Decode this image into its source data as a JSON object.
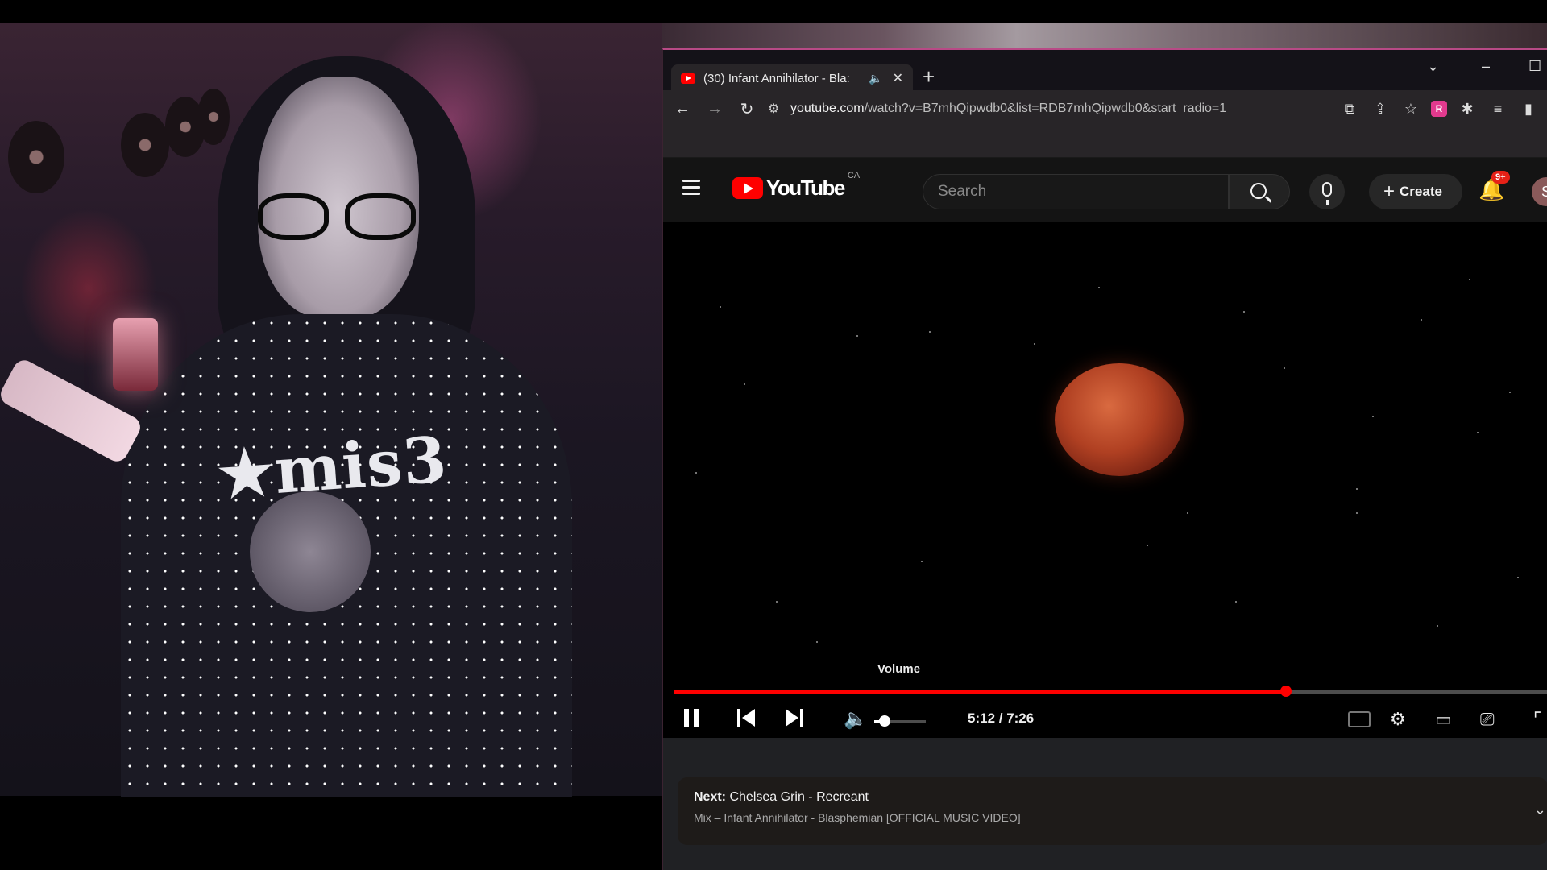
{
  "browser": {
    "tab_title": "(30) Infant Annihilator - Bla:",
    "tab_icons": {
      "favicon": "youtube-favicon",
      "audio": "speaker-icon",
      "close": "close-icon"
    },
    "new_tab_label": "+",
    "url_host": "youtube.com",
    "url_path": "/watch?v=B7mhQipwdb0&list=RDB7mhQipwdb0&start_radio=1",
    "window_controls": {
      "dropdown": "⌄",
      "minimize": "–",
      "maximize": "☐"
    }
  },
  "youtube": {
    "logo_text": "YouTube",
    "country_code": "CA",
    "search_placeholder": "Search",
    "create_label": "Create",
    "notification_badge": "9+",
    "avatar_letter": "S",
    "accent_color": "#ff0000"
  },
  "player": {
    "tooltip": "Volume",
    "time_display": "5:12 / 7:26",
    "progress_fraction": 0.7,
    "volume_fraction": 0.2,
    "is_playing": true
  },
  "up_next": {
    "label": "Next:",
    "title": "Chelsea Grin - Recreant",
    "subtitle": "Mix – Infant Annihilator - Blasphemian [OFFICIAL MUSIC VIDEO]"
  },
  "webcam": {
    "shirt_text": "★mis3"
  }
}
